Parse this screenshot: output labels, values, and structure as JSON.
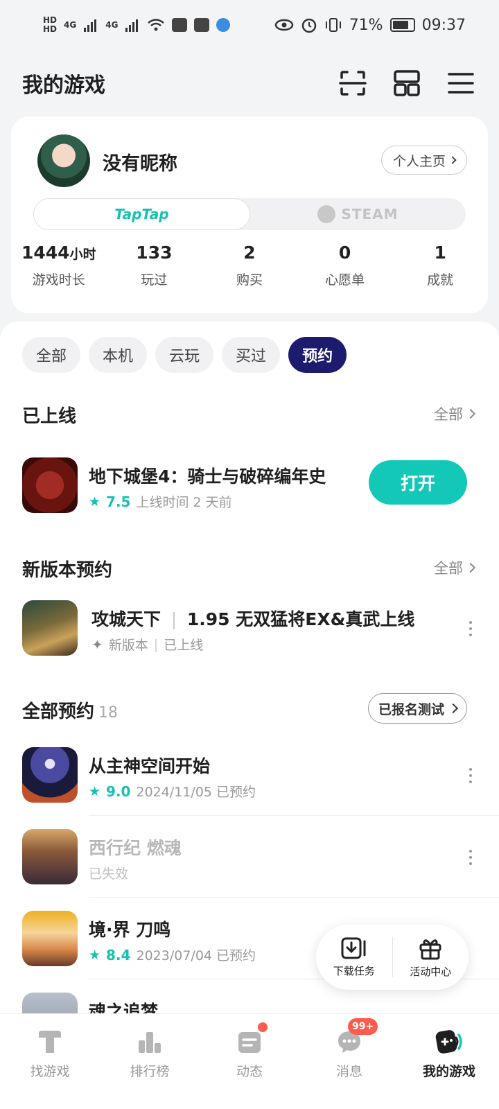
{
  "status_bar": {
    "hd1": "HD",
    "hd2": "HD",
    "net1": "4G",
    "net2": "4G",
    "battery": "71%",
    "time": "09:37"
  },
  "header": {
    "title": "我的游戏"
  },
  "profile": {
    "nickname": "没有昵称",
    "homepage_label": "个人主页",
    "platform_taptap": "TapTap",
    "platform_steam": "STEAM",
    "stats": [
      {
        "value": "1444",
        "unit": "小时",
        "label": "游戏时长"
      },
      {
        "value": "133",
        "unit": "",
        "label": "玩过"
      },
      {
        "value": "2",
        "unit": "",
        "label": "购买"
      },
      {
        "value": "0",
        "unit": "",
        "label": "心愿单"
      },
      {
        "value": "1",
        "unit": "",
        "label": "成就"
      }
    ]
  },
  "filters": [
    "全部",
    "本机",
    "云玩",
    "买过",
    "预约"
  ],
  "online_section": {
    "title": "已上线",
    "more": "全部",
    "game": {
      "name": "地下城堡4：骑士与破碎编年史",
      "rating": "7.5",
      "meta": "上线时间 2 天前",
      "action": "打开"
    }
  },
  "new_version_section": {
    "title": "新版本预约",
    "more": "全部",
    "game": {
      "name": "攻城天下",
      "subtitle": "1.95 无双猛将EX&真武上线",
      "tag1": "新版本",
      "tag2": "已上线"
    }
  },
  "reservations_section": {
    "title": "全部预约",
    "count": "18",
    "registered_btn": "已报名测试",
    "games": [
      {
        "name": "从主神空间开始",
        "rating": "9.0",
        "meta": "2024/11/05 已预约"
      },
      {
        "name": "西行纪 燃魂",
        "rating": "",
        "meta": "已失效"
      },
      {
        "name": "境·界 刀鸣",
        "rating": "8.4",
        "meta": "2023/07/04 已预约"
      },
      {
        "name": "魂之追梦",
        "rating": "",
        "meta": ""
      }
    ]
  },
  "floating_panel": {
    "download": "下载任务",
    "activity": "活动中心"
  },
  "bottom_nav": [
    {
      "label": "找游戏"
    },
    {
      "label": "排行榜"
    },
    {
      "label": "动态"
    },
    {
      "label": "消息",
      "badge": "99+"
    },
    {
      "label": "我的游戏"
    }
  ],
  "colors": {
    "accent": "#14c8b8",
    "chip_active": "#1c1b6e",
    "badge": "#ff5a4d"
  }
}
